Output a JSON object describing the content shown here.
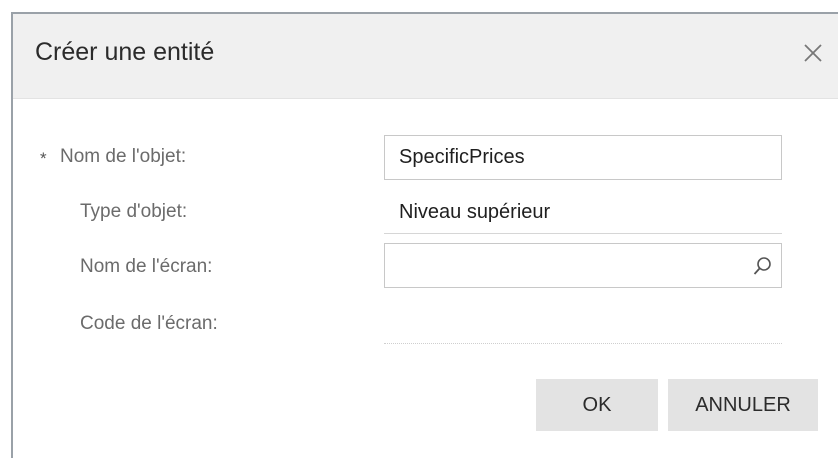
{
  "dialog": {
    "title": "Créer une entité",
    "close_icon": "close-icon"
  },
  "form": {
    "object_name": {
      "label": "Nom de l'objet:",
      "required": true,
      "required_marker": "*",
      "value": "SpecificPrices"
    },
    "object_type": {
      "label": "Type d'objet:",
      "value": "Niveau supérieur"
    },
    "screen_name": {
      "label": "Nom de l'écran:",
      "value": "",
      "icon": "search-icon"
    },
    "screen_code": {
      "label": "Code de l'écran:",
      "value": ""
    }
  },
  "buttons": {
    "ok": "OK",
    "cancel": "ANNULER"
  }
}
